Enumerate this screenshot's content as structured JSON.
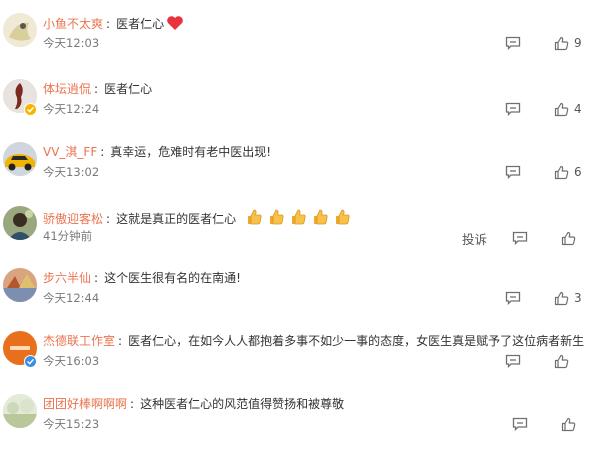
{
  "comments": [
    {
      "username": "小鱼不太爽",
      "text": "医者仁心",
      "time": "今天12:03",
      "likes": "9",
      "emoji": "heart-emoji",
      "verified": "",
      "avatar_color": "#e8e0c8"
    },
    {
      "username": "体坛逍侃",
      "text": "医者仁心",
      "time": "今天12:24",
      "likes": "4",
      "verified": "yellow",
      "avatar_color": "#8a3a2a"
    },
    {
      "username": "VV_淇_FF",
      "text": "真幸运，危难时有老中医出现!",
      "time": "今天13:02",
      "likes": "6",
      "verified": "",
      "avatar_color": "#e2a300"
    },
    {
      "username": "骄傲迎客松",
      "text": "这就是真正的医者仁心",
      "time": "41分钟前",
      "likes": "",
      "report_label": "投诉",
      "emoji": "thumbs-up-emoji",
      "verified": "",
      "avatar_color": "#6b7d55"
    },
    {
      "username": "步六半仙",
      "text": "这个医生很有名的在南通!",
      "time": "今天12:44",
      "likes": "3",
      "verified": "",
      "avatar_color": "#c97a54"
    },
    {
      "username": "杰德联工作室",
      "text": "医者仁心，在如今人人都抱着多事不如少一事的态度，女医生真是赋予了这位病者新生",
      "time": "今天16:03",
      "likes": "",
      "verified": "blue",
      "avatar_color": "#e86d1f"
    },
    {
      "username": "团团好棒啊啊啊",
      "text": "这种医者仁心的风范值得赞扬和被尊敬",
      "time": "今天15:23",
      "likes": "",
      "verified": "",
      "avatar_color": "#d8dfc8"
    }
  ],
  "colors": {
    "username": "#eb7350",
    "text": "#333333",
    "meta": "#7a7a7a",
    "icon": "#6f6f6f",
    "verified_yellow": "#f7b500",
    "verified_blue": "#3a8ee6"
  }
}
